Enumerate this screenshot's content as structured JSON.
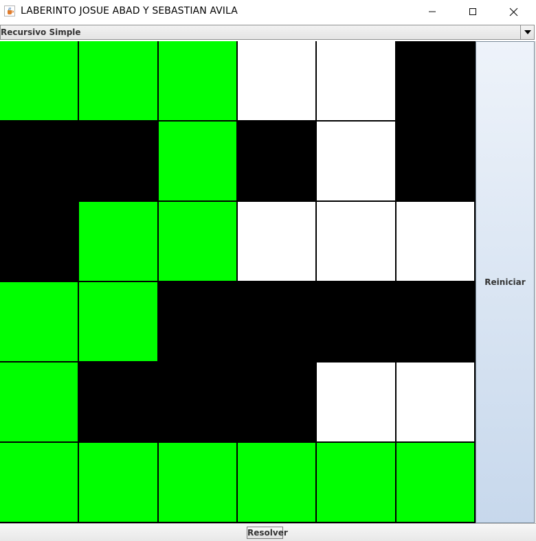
{
  "window": {
    "title": "LABERINTO JOSUE ABAD Y SEBASTIAN AVILA",
    "icon": "java-cup-icon",
    "controls": [
      "minimize-icon",
      "maximize-icon",
      "close-icon"
    ]
  },
  "algorithm_select": {
    "selected": "Recursivo Simple",
    "icon": "chevron-down-icon"
  },
  "maze": {
    "rows": 6,
    "cols": 6,
    "colors": {
      "path": "#00ff00",
      "wall": "#000000",
      "open": "#ffffff"
    },
    "cells": [
      [
        "path",
        "path",
        "path",
        "open",
        "open",
        "wall"
      ],
      [
        "wall",
        "wall",
        "path",
        "wall",
        "open",
        "wall"
      ],
      [
        "wall",
        "path",
        "path",
        "open",
        "open",
        "open"
      ],
      [
        "path",
        "path",
        "wall",
        "wall",
        "wall",
        "wall"
      ],
      [
        "path",
        "wall",
        "wall",
        "wall",
        "open",
        "open"
      ],
      [
        "path",
        "path",
        "path",
        "path",
        "path",
        "path"
      ]
    ]
  },
  "buttons": {
    "reset_label": "Reiniciar",
    "solve_label": "Resolver"
  }
}
